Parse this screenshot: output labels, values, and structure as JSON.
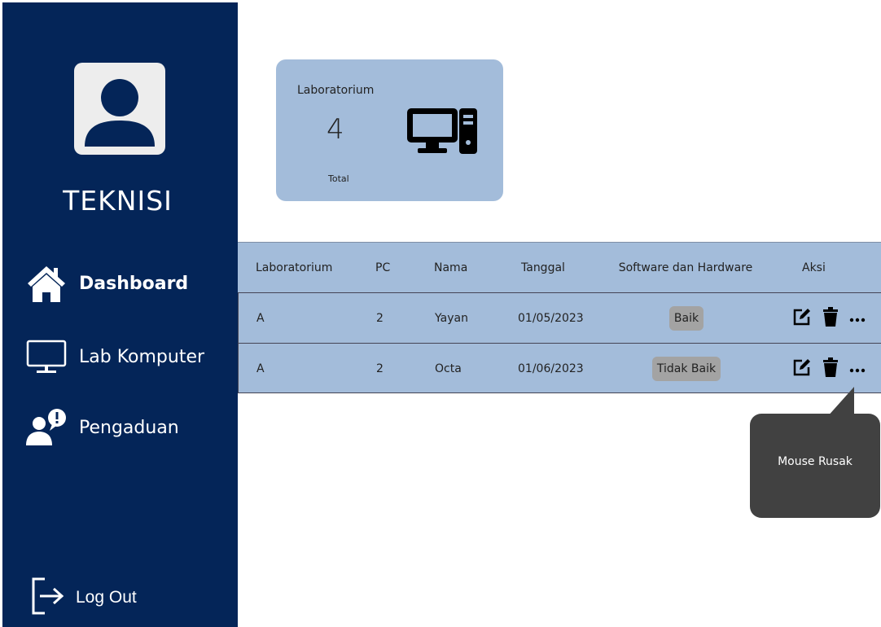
{
  "sidebar": {
    "role": "TEKNISI",
    "nav": {
      "dashboard": "Dashboard",
      "lab_komputer": "Lab Komputer",
      "pengaduan": "Pengaduan"
    },
    "logout": "Log Out"
  },
  "card": {
    "title": "Laboratorium",
    "count": "4",
    "footer": "Total",
    "icon": "desktop-computer-icon"
  },
  "table": {
    "headers": {
      "laboratorium": "Laboratorium",
      "pc": "PC",
      "nama": "Nama",
      "tanggal": "Tanggal",
      "software_hardware": "Software  dan Hardware",
      "aksi": "Aksi"
    },
    "rows": [
      {
        "laboratorium": "A",
        "pc": "2",
        "nama": "Yayan",
        "tanggal": "01/05/2023",
        "status": "Baik"
      },
      {
        "laboratorium": "A",
        "pc": "2",
        "nama": "Octa",
        "tanggal": "01/06/2023",
        "status": "Tidak Baik"
      }
    ]
  },
  "tooltip": {
    "text": "Mouse Rusak"
  },
  "colors": {
    "sidebar": "#042558",
    "card": "#a3bcda",
    "badge": "#a3a3a3",
    "tooltip": "#414141"
  }
}
